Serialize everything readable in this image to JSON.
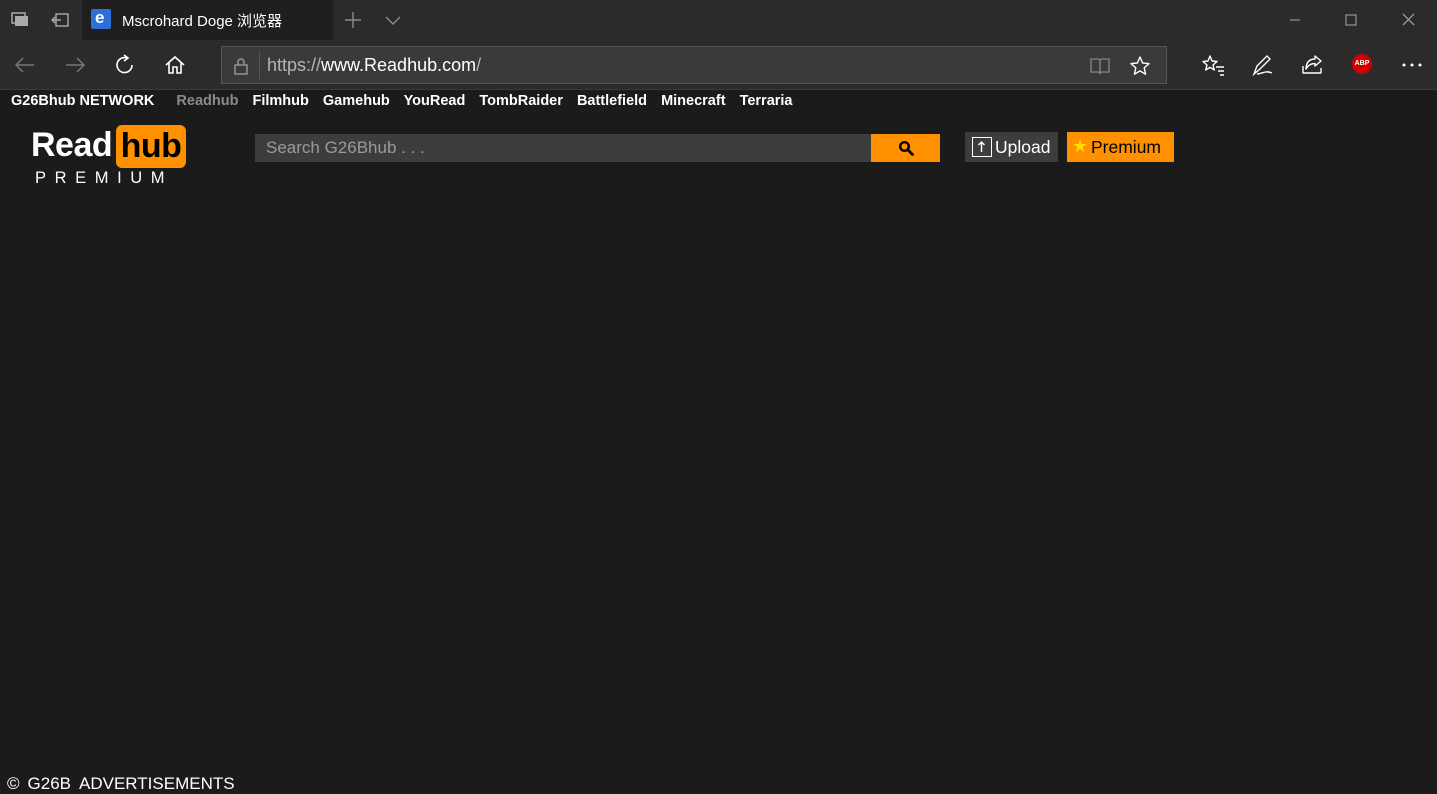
{
  "browser": {
    "tab_title": "Mscrohard Doge 浏览器",
    "favicon_letter": "e",
    "url": {
      "protocol": "https://",
      "host": "www.Readhub.com",
      "path": "/"
    },
    "abp_label": "ABP"
  },
  "network": {
    "brand": "G26Bhub NETWORK",
    "items": [
      "Readhub",
      "Filmhub",
      "Gamehub",
      "YouRead",
      "TombRaider",
      "Battlefield",
      "Minecraft",
      "Terraria"
    ],
    "current_index": 0
  },
  "logo": {
    "left": "Read",
    "right": "hub",
    "subtitle": "PREMIUM"
  },
  "search": {
    "placeholder": "Search G26Bhub . . ."
  },
  "buttons": {
    "upload": "Upload",
    "premium": "Premium",
    "premium_star": "★"
  },
  "footer": {
    "copyright": "©",
    "company": "G26B",
    "link": "ADVERTISEMENTS"
  },
  "colors": {
    "accent": "#ff9000",
    "background": "#1b1b1b"
  }
}
